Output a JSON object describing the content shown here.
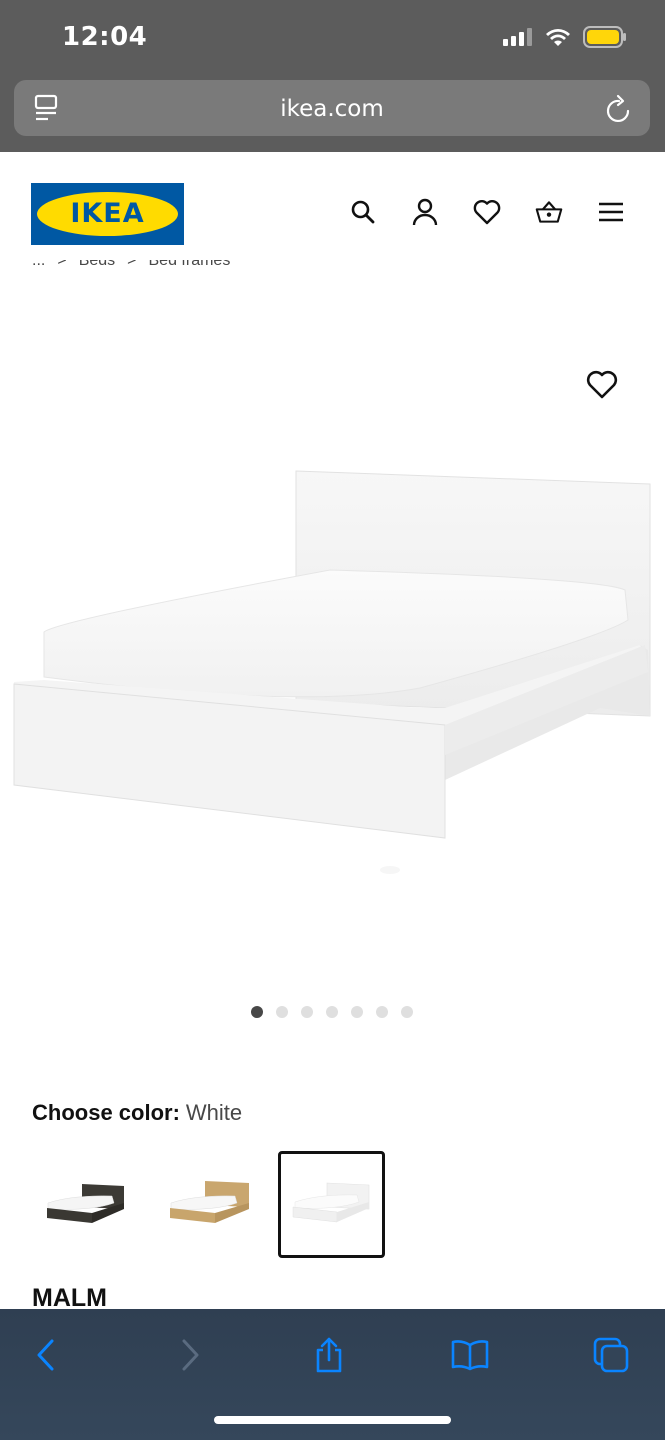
{
  "status_bar": {
    "time": "12:04",
    "battery_color": "#ffd60a"
  },
  "browser": {
    "url": "ikea.com",
    "left_icon": "tabs-list-icon",
    "right_icon": "reload-icon"
  },
  "header": {
    "logo_text": "IKEA",
    "icons": [
      "search-icon",
      "account-icon",
      "favorites-icon",
      "cart-icon",
      "menu-icon"
    ]
  },
  "breadcrumb": {
    "items": [
      "...",
      "Beds",
      "Bed frames"
    ],
    "separator": ">"
  },
  "product": {
    "image_count": 7,
    "active_image": 1,
    "color_label": "Choose color:",
    "color_value": "White",
    "swatches": [
      "black-brown",
      "oak veneer",
      "white"
    ],
    "selected_swatch": 3,
    "name": "MALM"
  },
  "toolbar": {
    "buttons": [
      "back-icon",
      "forward-icon",
      "share-icon",
      "bookmarks-icon",
      "tabs-icon"
    ]
  },
  "colors": {
    "ikea_blue": "#0058a3",
    "ikea_yellow": "#ffdb00",
    "toolbar_bg": "#334457",
    "accent": "#0a84ff"
  }
}
